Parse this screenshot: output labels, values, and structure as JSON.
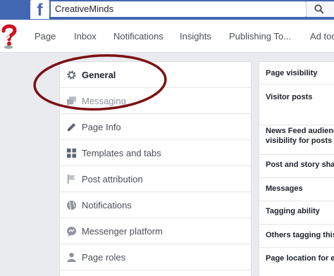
{
  "search": {
    "value": "CreativeMinds"
  },
  "nav": {
    "items": [
      "Page",
      "Inbox",
      "Notifications",
      "Insights",
      "Publishing To...",
      "Ad too"
    ]
  },
  "settings_menu": {
    "items": [
      {
        "label": "General",
        "icon": "gear-icon",
        "state": "active"
      },
      {
        "label": "Messaging",
        "icon": "chat-icon",
        "state": "faded"
      },
      {
        "label": "Page Info",
        "icon": "pencil-icon",
        "state": "normal"
      },
      {
        "label": "Templates and tabs",
        "icon": "grid-icon",
        "state": "normal"
      },
      {
        "label": "Post attribution",
        "icon": "flag-icon",
        "state": "normal"
      },
      {
        "label": "Notifications",
        "icon": "globe-icon",
        "state": "normal"
      },
      {
        "label": "Messenger platform",
        "icon": "messenger-icon",
        "state": "normal"
      },
      {
        "label": "Page roles",
        "icon": "person-icon",
        "state": "normal"
      }
    ]
  },
  "general_settings": {
    "rows": [
      {
        "lines": [
          "Page visibility"
        ]
      },
      {
        "lines": [
          "Visitor posts"
        ]
      },
      {
        "lines": [
          "News Feed audience",
          "visibility for posts"
        ]
      },
      {
        "lines": [
          "Post and story sha"
        ]
      },
      {
        "lines": [
          "Messages"
        ]
      },
      {
        "lines": [
          "Tagging ability"
        ]
      },
      {
        "lines": [
          "Others tagging this"
        ]
      },
      {
        "lines": [
          "Page location for e"
        ]
      }
    ]
  },
  "colors": {
    "brand_blue": "#4267b2",
    "annotation": "#7b1113"
  }
}
